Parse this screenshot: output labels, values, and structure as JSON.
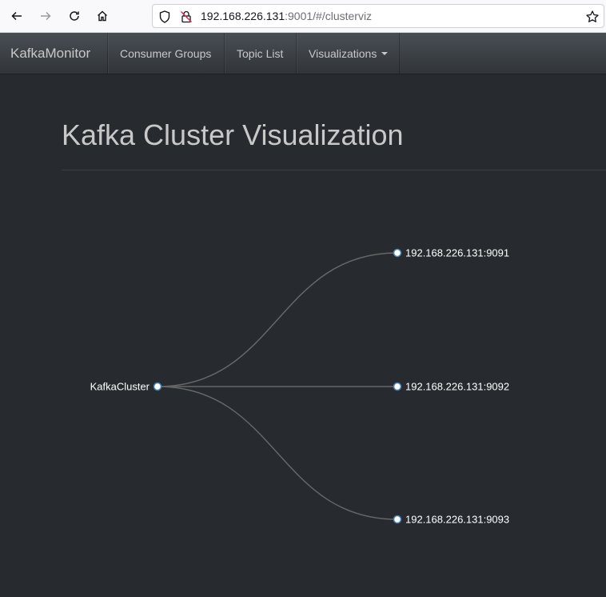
{
  "browser": {
    "url_host": "192.168.226.131",
    "url_rest": ":9001/#/clusterviz"
  },
  "navbar": {
    "brand": "KafkaMonitor",
    "items": [
      {
        "label": "Consumer Groups"
      },
      {
        "label": "Topic List"
      },
      {
        "label": "Visualizations"
      }
    ]
  },
  "page": {
    "title": "Kafka Cluster Visualization"
  },
  "tree": {
    "root": "KafkaCluster",
    "children": [
      "192.168.226.131:9091",
      "192.168.226.131:9092",
      "192.168.226.131:9093"
    ]
  },
  "colors": {
    "background": "#272b30",
    "link": "#666666",
    "node_fill": "#ffffff",
    "node_stroke": "#4682b4"
  }
}
